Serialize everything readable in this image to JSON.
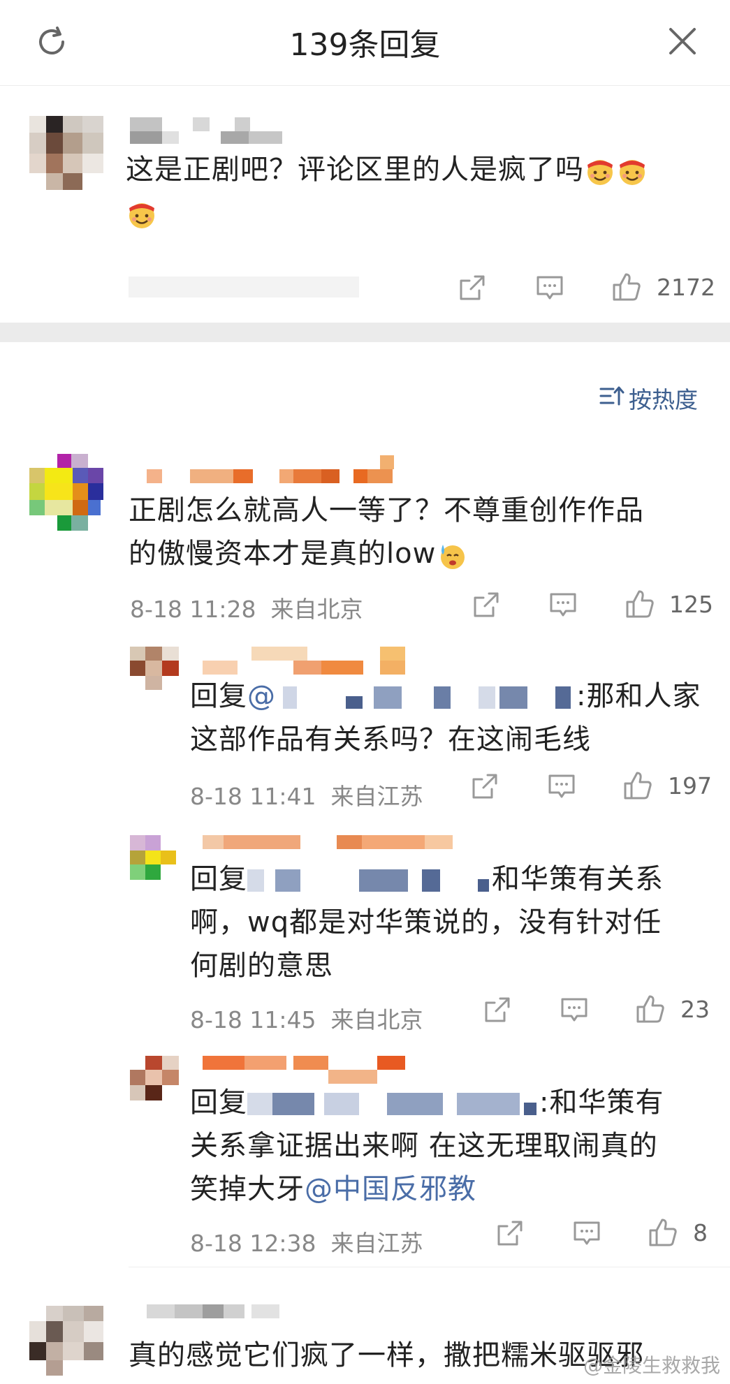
{
  "header": {
    "title": "139条回复",
    "refresh_icon": "refresh-icon",
    "close_icon": "close-icon"
  },
  "root_comment": {
    "text": "这是正剧吧？评论区里的人是疯了吗",
    "emoji": "cheer-emoji",
    "likes": "2172"
  },
  "sort": {
    "label": "按热度",
    "icon": "sort-icon"
  },
  "replies": [
    {
      "text_line1": "正剧怎么就高人一等了？不尊重创作作品",
      "text_line2": "的傲慢资本才是真的low",
      "time": "8-18 11:28",
      "location": "来自北京",
      "likes": "125"
    },
    {
      "prefix": "回复",
      "mention_start": "@",
      "text_line1_end": ":那和人家",
      "text_line2": "这部作品有关系吗？在这闹毛线",
      "time": "8-18 11:41",
      "location": "来自江苏",
      "likes": "197"
    },
    {
      "prefix": "回复",
      "text_line1_end": "和华策有关系",
      "text_line2": "啊，wq都是对华策说的，没有针对任",
      "text_line3": "何剧的意思",
      "time": "8-18 11:45",
      "location": "来自北京",
      "likes": "23"
    },
    {
      "prefix": "回复",
      "text_line1_end": ":和华策有",
      "text_line2": "关系拿证据出来啊 在这无理取闹真的",
      "text_line3_plain": "笑掉大牙",
      "text_line3_mention": "@中国反邪教",
      "time": "8-18 12:38",
      "location": "来自江苏",
      "likes": "8"
    },
    {
      "text_line1": "真的感觉它们疯了一样，撒把糯米驱驱邪"
    }
  ],
  "watermark": "@金陵生救救我",
  "colors": {
    "accent_blue": "#4a6da7",
    "meta_gray": "#888888",
    "band": "#ebebeb"
  }
}
